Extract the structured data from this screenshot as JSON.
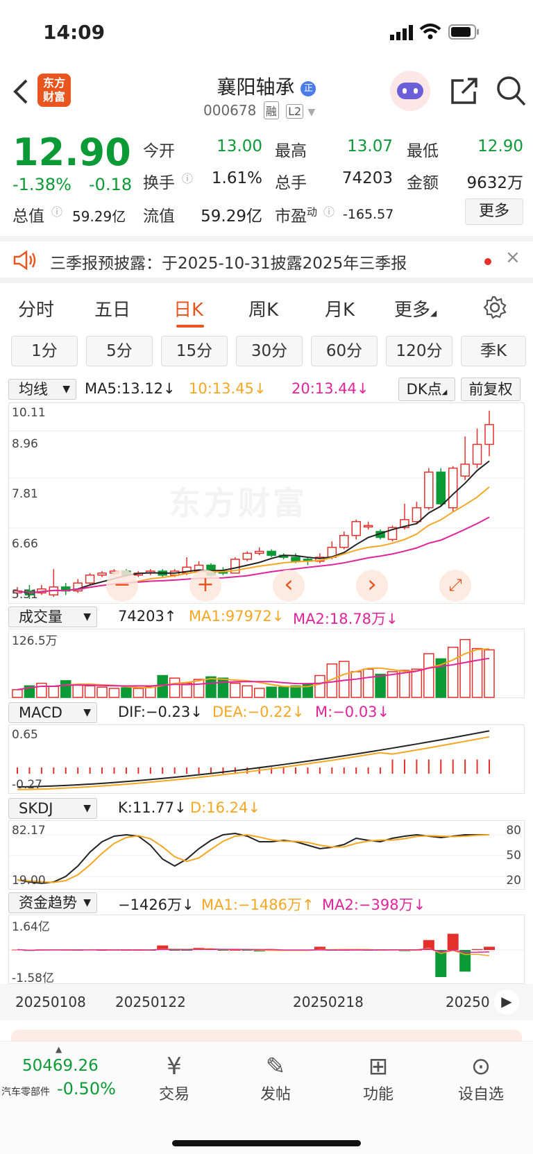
{
  "status": {
    "time": "14:09"
  },
  "header": {
    "logo_text": [
      "东方",
      "财富"
    ],
    "stock_name": "襄阳轴承",
    "badge": "正",
    "stock_code": "000678",
    "tags": [
      "融",
      "L2"
    ]
  },
  "quote": {
    "price": "12.90",
    "change_pct": "-1.38%",
    "change": "-0.18",
    "open_label": "今开",
    "open": "13.00",
    "high_label": "最高",
    "high": "13.07",
    "low_label": "最低",
    "low": "12.90",
    "turnover_label": "换手",
    "turnover": "1.61%",
    "volume_label": "总手",
    "volume": "74203",
    "amount_label": "金额",
    "amount": "9632万",
    "mktcap_label": "总值",
    "mktcap": "59.29亿",
    "float_label": "流值",
    "float": "59.29亿",
    "pe_label": "市盈",
    "pe_sup": "动",
    "pe": "-165.57",
    "more": "更多"
  },
  "notice": {
    "text": "三季报预披露：于2025-10-31披露2025年三季报"
  },
  "period_tabs": [
    "分时",
    "五日",
    "日K",
    "周K",
    "月K",
    "更多"
  ],
  "period_active": "日K",
  "minute_tabs": [
    "1分",
    "5分",
    "15分",
    "30分",
    "60分",
    "120分",
    "季K"
  ],
  "kline": {
    "selector": "均线",
    "ma5": "MA5:13.12↓",
    "ma10": "10:13.45↓",
    "ma20": "20:13.44↓",
    "dk": "DK点",
    "adjust": "前复权",
    "watermark": "东方财富",
    "y_labels": [
      "10.11",
      "8.96",
      "7.81",
      "6.66",
      "5.51"
    ],
    "controls": [
      "−",
      "+",
      "‹",
      "›",
      "⤢"
    ]
  },
  "volume": {
    "selector": "成交量",
    "v": "74203↑",
    "ma1": "MA1:97972↓",
    "ma2": "MA2:18.78万↓",
    "y_top": "126.5万"
  },
  "macd": {
    "selector": "MACD",
    "dif": "DIF:−0.23↓",
    "dea": "DEA:−0.22↓",
    "m": "M:−0.03↓",
    "y_top": "0.65",
    "y_bot": "-0.27"
  },
  "skdj": {
    "selector": "SKDJ",
    "k": "K:11.77↓",
    "d": "D:16.24↓",
    "y_top": "82.17",
    "y_bot": "19.00",
    "r80": "80",
    "r50": "50",
    "r20": "20"
  },
  "fund": {
    "selector": "资金趋势",
    "v": "−1426万↓",
    "ma1": "MA1:−1486万↑",
    "ma2": "MA2:−398万↓",
    "y_top": "1.64亿",
    "y_bot": "-1.58亿"
  },
  "dates": [
    "20250108",
    "20250122",
    "20250218",
    "20250"
  ],
  "bottom": {
    "index_value": "50469.26",
    "index_name": "汽车零部件",
    "index_change": "-0.50%",
    "items": [
      "交易",
      "发帖",
      "功能",
      "设自选"
    ]
  },
  "colors": {
    "up": "#e4302b",
    "down": "#0b9a35",
    "ma5": "#222222",
    "ma10": "#f5a623",
    "ma20": "#e0249a",
    "accent": "#e8551f"
  }
}
